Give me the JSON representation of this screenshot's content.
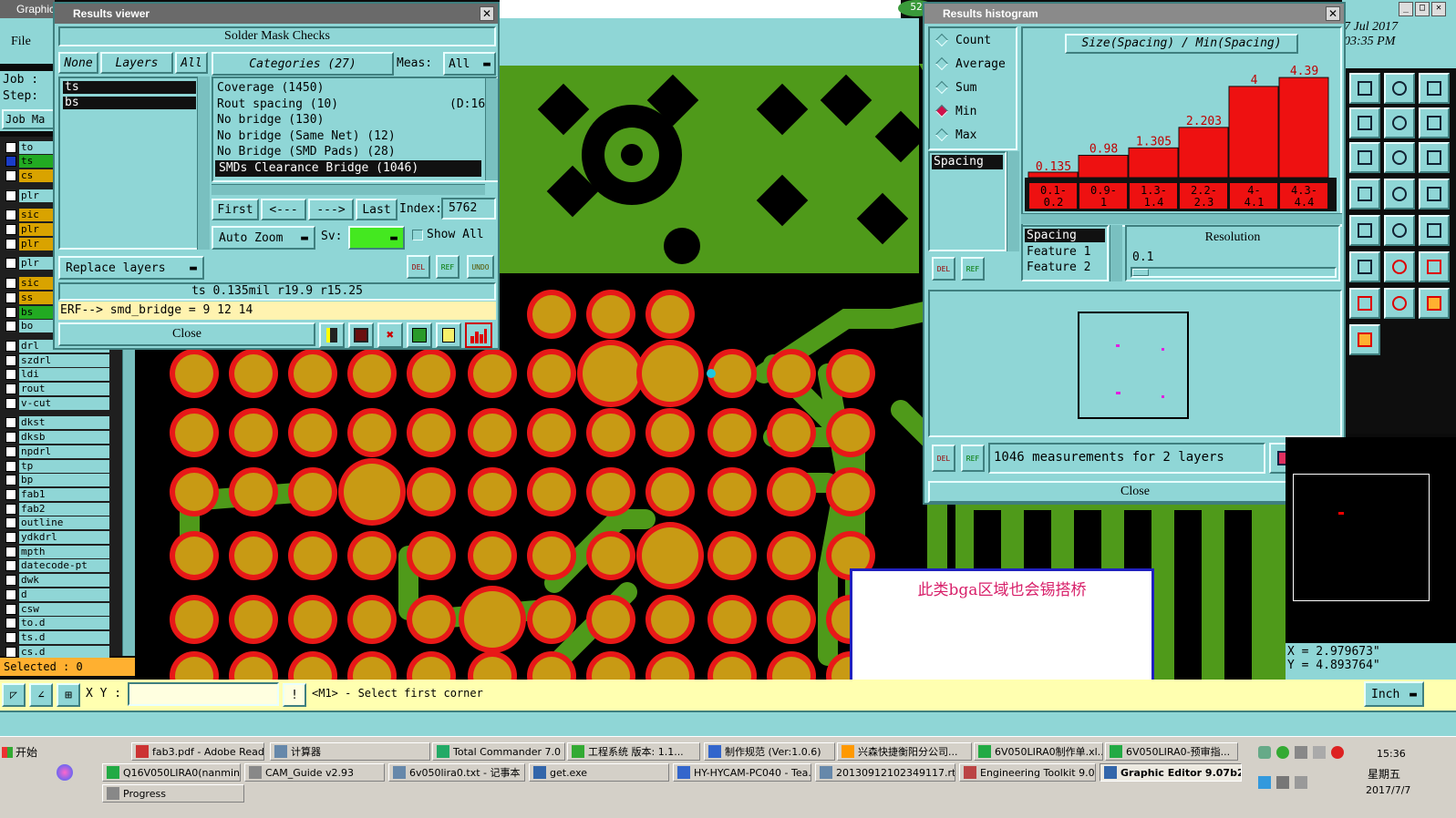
{
  "main_window": {
    "title": "Graphic",
    "menu_file": "File",
    "job_label": "Job :",
    "step_label": "Step:",
    "job_matrix": "Job Ma",
    "date": "7 Jul 2017",
    "time": "03:35 PM",
    "unit": "Inch",
    "xy_label": "X Y :",
    "xy_value": "",
    "prompt": "<M1> - Select first corner",
    "coord_x": "X = 2.979673\"",
    "coord_y": "Y = 4.893764\"",
    "selected": "Selected : 0",
    "counter_badge": "52"
  },
  "layers": [
    {
      "name": "to",
      "color": "#ffffff",
      "hl": "#8fd6d6"
    },
    {
      "name": "ts",
      "color": "#1a3cc8",
      "hl": "#22aa22"
    },
    {
      "name": "cs",
      "color": "#ffffff",
      "hl": "#d9a300"
    },
    {
      "name": "plr",
      "color": "#ffffff",
      "hl": "#8fd6d6"
    },
    {
      "name": "sic",
      "color": "#ffffff",
      "hl": "#d9a300"
    },
    {
      "name": "plr",
      "color": "#ffffff",
      "hl": "#d9a300"
    },
    {
      "name": "plr",
      "color": "#ffffff",
      "hl": "#d9a300"
    },
    {
      "name": "plr",
      "color": "#ffffff",
      "hl": "#8fd6d6"
    },
    {
      "name": "sic",
      "color": "#ffffff",
      "hl": "#d9a300"
    },
    {
      "name": "ss",
      "color": "#ffffff",
      "hl": "#d9a300"
    },
    {
      "name": "bs",
      "color": "#ffffff",
      "hl": "#22aa22"
    },
    {
      "name": "bo",
      "color": "#ffffff",
      "hl": "#8fd6d6"
    },
    {
      "name": "drl",
      "color": "#ffffff",
      "hl": "#8fd6d6"
    },
    {
      "name": "szdrl",
      "color": "#ffffff",
      "hl": "#8fd6d6"
    },
    {
      "name": "ldi",
      "color": "#ffffff",
      "hl": "#8fd6d6"
    },
    {
      "name": "rout",
      "color": "#ffffff",
      "hl": "#8fd6d6"
    },
    {
      "name": "v-cut",
      "color": "#ffffff",
      "hl": "#8fd6d6"
    },
    {
      "name": "dkst",
      "color": "#ffffff",
      "hl": "#8fd6d6"
    },
    {
      "name": "dksb",
      "color": "#ffffff",
      "hl": "#8fd6d6"
    },
    {
      "name": "npdrl",
      "color": "#ffffff",
      "hl": "#8fd6d6"
    },
    {
      "name": "tp",
      "color": "#ffffff",
      "hl": "#8fd6d6"
    },
    {
      "name": "bp",
      "color": "#ffffff",
      "hl": "#8fd6d6"
    },
    {
      "name": "fab1",
      "color": "#ffffff",
      "hl": "#8fd6d6"
    },
    {
      "name": "fab2",
      "color": "#ffffff",
      "hl": "#8fd6d6"
    },
    {
      "name": "outline",
      "color": "#ffffff",
      "hl": "#8fd6d6"
    },
    {
      "name": "ydkdrl",
      "color": "#ffffff",
      "hl": "#8fd6d6"
    },
    {
      "name": "mpth",
      "color": "#ffffff",
      "hl": "#8fd6d6"
    },
    {
      "name": "datecode-pt",
      "color": "#ffffff",
      "hl": "#8fd6d6"
    },
    {
      "name": "dwk",
      "color": "#ffffff",
      "hl": "#8fd6d6"
    },
    {
      "name": "d",
      "color": "#ffffff",
      "hl": "#8fd6d6"
    },
    {
      "name": "csw",
      "color": "#ffffff",
      "hl": "#8fd6d6"
    },
    {
      "name": "to.d",
      "color": "#ffffff",
      "hl": "#8fd6d6"
    },
    {
      "name": "ts.d",
      "color": "#ffffff",
      "hl": "#8fd6d6"
    },
    {
      "name": "cs.d",
      "color": "#ffffff",
      "hl": "#8fd6d6"
    }
  ],
  "results_viewer": {
    "title": "Results viewer",
    "section": "Solder Mask Checks",
    "btn_none": "None",
    "btn_layers": "Layers",
    "btn_all": "All",
    "layer_list": [
      "ts",
      "bs"
    ],
    "categories_label": "Categories (27)",
    "meas_label": "Meas:",
    "meas_value": "All",
    "categories": [
      {
        "text": "Coverage (1450)",
        "extra": ""
      },
      {
        "text": "Rout spacing (10)",
        "extra": "(D:16)"
      },
      {
        "text": "No bridge (130)",
        "extra": ""
      },
      {
        "text": "No bridge (Same Net) (12)",
        "extra": ""
      },
      {
        "text": "No Bridge (SMD Pads) (28)",
        "extra": ""
      },
      {
        "text": "SMDs Clearance Bridge (1046)",
        "extra": ""
      }
    ],
    "btn_first": "First",
    "btn_prev": "<---",
    "btn_next": "--->",
    "btn_last": "Last",
    "index_label": "Index:",
    "index_value": "5762",
    "auto_zoom": "Auto Zoom",
    "sv_label": "Sv:",
    "show_all": "Show All",
    "replace_layers": "Replace layers",
    "status_line": "ts 0.135mil   r19.9   r15.25",
    "erf_line": "ERF--> smd_bridge = 9 12 14",
    "close": "Close",
    "del": "DEL",
    "ref": "REF",
    "undo": "UNDO"
  },
  "histogram": {
    "title": "Results histogram",
    "options": [
      "Count",
      "Average",
      "Sum",
      "Min",
      "Max"
    ],
    "selected_option": "Min",
    "list_item": "Spacing",
    "chart_title": "Size(Spacing) / Min(Spacing)",
    "spacing": "Spacing",
    "feature1": "Feature 1",
    "feature2": "Feature 2",
    "resolution_label": "Resolution",
    "resolution_value": "0.1",
    "summary": "1046 measurements for 2 layers",
    "close": "Close",
    "del": "DEL",
    "ref": "REF"
  },
  "chart_data": {
    "type": "bar",
    "title": "Size(Spacing) / Min(Spacing)",
    "categories": [
      "0.1-\n0.2",
      "0.9-\n1",
      "1.3-\n1.4",
      "2.2-\n2.3",
      "4-\n4.1",
      "4.3-\n4.4"
    ],
    "values": [
      0.135,
      0.98,
      1.305,
      2.203,
      4,
      4.39
    ],
    "value_labels": [
      "0.135",
      "0.98",
      "1.305",
      "2.203",
      "4",
      "4.39"
    ],
    "ylim": [
      0,
      4.4
    ],
    "bar_color": "#ee1111"
  },
  "annotation": {
    "text": "此类bga区域也会锡搭桥"
  },
  "taskbar": {
    "start": "开始",
    "clock_time": "15:36",
    "clock_day": "星期五",
    "clock_date": "2017/7/7",
    "row1": [
      "fab3.pdf - Adobe Reader",
      "计算器",
      "Total Commander 7.0 ...",
      "工程系统  版本: 1.1...",
      "制作规范 (Ver:1.0.6)",
      "兴森快捷衡阳分公司...",
      "6V050LIRA0制作单.xl...",
      "6V050LIRA0-预审指..."
    ],
    "row2": [
      "Q16V050LIRA0(nanmin)...",
      "CAM_Guide v2.93",
      "6v050lira0.txt - 记事本",
      "get.exe",
      "HY-HYCAM-PC040 - Tea...",
      "20130912102349117.rt...",
      "Engineering Toolkit 9.07...",
      "Graphic Editor 9.07b2..."
    ],
    "row3": [
      "Progress"
    ]
  }
}
